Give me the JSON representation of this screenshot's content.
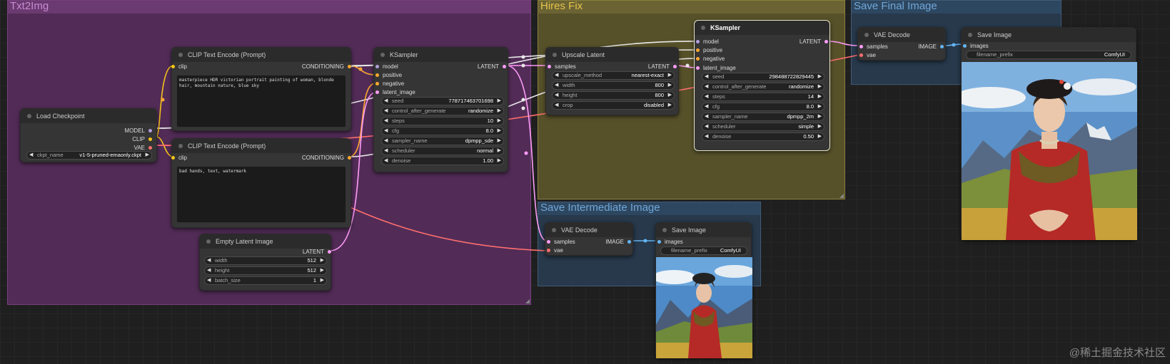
{
  "groups": {
    "txt2img": "Txt2Img",
    "hires": "Hires Fix",
    "intermediate": "Save Intermediate Image",
    "final": "Save Final Image"
  },
  "nodes": {
    "load_checkpoint": {
      "title": "Load Checkpoint",
      "outputs": [
        "MODEL",
        "CLIP",
        "VAE"
      ],
      "ckpt_name_label": "ckpt_name",
      "ckpt_name_value": "v1-5-pruned-emaonly.ckpt"
    },
    "clip_pos": {
      "title": "CLIP Text Encode (Prompt)",
      "input": "clip",
      "output": "CONDITIONING",
      "text": "masterpiece HDR victorian portrait painting of woman, blonde hair, mountain nature, blue sky"
    },
    "clip_neg": {
      "title": "CLIP Text Encode (Prompt)",
      "input": "clip",
      "output": "CONDITIONING",
      "text": "bad hands, text, watermark"
    },
    "empty_latent": {
      "title": "Empty Latent Image",
      "output": "LATENT",
      "widgets": [
        {
          "name": "width",
          "value": "512"
        },
        {
          "name": "height",
          "value": "512"
        },
        {
          "name": "batch_size",
          "value": "1"
        }
      ]
    },
    "ksampler1": {
      "title": "KSampler",
      "inputs": [
        "model",
        "positive",
        "negative",
        "latent_image"
      ],
      "output": "LATENT",
      "widgets": [
        {
          "name": "seed",
          "value": "778717463701698"
        },
        {
          "name": "control_after_generate",
          "value": "randomize"
        },
        {
          "name": "steps",
          "value": "10"
        },
        {
          "name": "cfg",
          "value": "8.0"
        },
        {
          "name": "sampler_name",
          "value": "dpmpp_sde"
        },
        {
          "name": "scheduler",
          "value": "normal"
        },
        {
          "name": "denoise",
          "value": "1.00"
        }
      ]
    },
    "upscale": {
      "title": "Upscale Latent",
      "input": "samples",
      "output": "LATENT",
      "widgets": [
        {
          "name": "upscale_method",
          "value": "nearest-exact"
        },
        {
          "name": "width",
          "value": "800"
        },
        {
          "name": "height",
          "value": "800"
        },
        {
          "name": "crop",
          "value": "disabled"
        }
      ]
    },
    "ksampler2": {
      "title": "KSampler",
      "inputs": [
        "model",
        "positive",
        "negative",
        "latent_image"
      ],
      "output": "LATENT",
      "widgets": [
        {
          "name": "seed",
          "value": "298488722829445"
        },
        {
          "name": "control_after_generate",
          "value": "randomize"
        },
        {
          "name": "steps",
          "value": "14"
        },
        {
          "name": "cfg",
          "value": "8.0"
        },
        {
          "name": "sampler_name",
          "value": "dpmpp_2m"
        },
        {
          "name": "scheduler",
          "value": "simple"
        },
        {
          "name": "denoise",
          "value": "0.50"
        }
      ]
    },
    "vae_decode1": {
      "title": "VAE Decode",
      "inputs": [
        "samples",
        "vae"
      ],
      "output": "IMAGE"
    },
    "save_image1": {
      "title": "Save Image",
      "input": "images",
      "prefix_label": "filename_prefix",
      "prefix_value": "ComfyUI"
    },
    "vae_decode2": {
      "title": "VAE Decode",
      "inputs": [
        "samples",
        "vae"
      ],
      "output": "IMAGE"
    },
    "save_image2": {
      "title": "Save Image",
      "input": "images",
      "prefix_label": "filename_prefix",
      "prefix_value": "ComfyUI"
    }
  },
  "colors": {
    "model": "#b39ddb",
    "clip": "#f5c518",
    "vae": "#ff6e6e",
    "conditioning": "#ffa931",
    "latent": "#ff9cf9",
    "image": "#64b5f6",
    "link": "#e8e8e8"
  },
  "watermark": "@稀土掘金技术社区"
}
